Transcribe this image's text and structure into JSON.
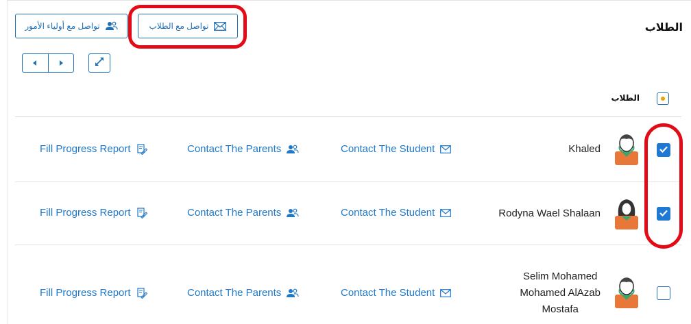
{
  "header": {
    "title": "الطلاب",
    "contact_parents_label": "تواصل مع أولياء الأمور",
    "contact_students_label": "تواصل مع الطلاب"
  },
  "table": {
    "column_students": "الطلاب"
  },
  "rows": [
    {
      "name": "Khaled",
      "checked": true,
      "avatar": "male-student-avatar",
      "fill_progress_label": "Fill Progress Report",
      "contact_parents_label": "Contact The Parents",
      "contact_student_label": "Contact The Student"
    },
    {
      "name": "Rodyna Wael Shalaan",
      "checked": true,
      "avatar": "female-student-avatar",
      "fill_progress_label": "Fill Progress Report",
      "contact_parents_label": "Contact The Parents",
      "contact_student_label": "Contact The Student"
    },
    {
      "name_lines": [
        "Selim Mohamed",
        "Mohamed AlAzab",
        "Mostafa"
      ],
      "checked": false,
      "avatar": "male-student-avatar",
      "fill_progress_label": "Fill Progress Report",
      "contact_parents_label": "Contact The Parents",
      "contact_student_label": "Contact The Student"
    }
  ],
  "colors": {
    "accent": "#1f6fb5",
    "link": "#1f78c8",
    "checkbox": "#1f78d1",
    "annotation": "#e30b17",
    "avatar_shirt": "#e8773a",
    "avatar_collar": "#3aa66a"
  }
}
